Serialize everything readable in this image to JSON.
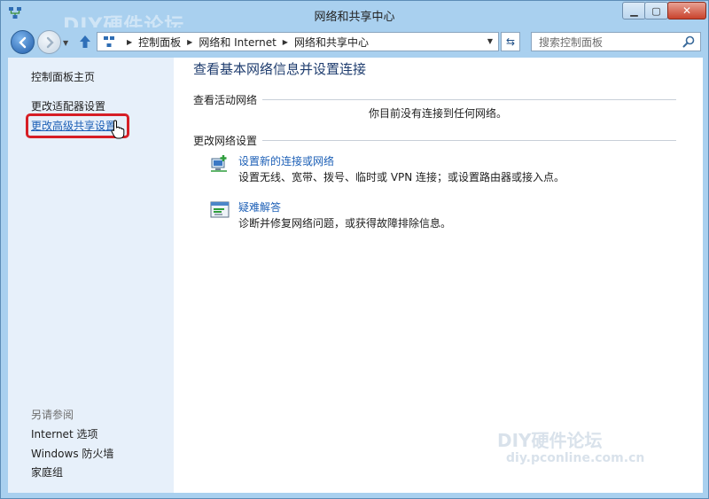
{
  "window": {
    "title": "网络和共享中心",
    "controls": {
      "minimize": "▁",
      "maximize": "▢",
      "close": "✕"
    }
  },
  "navigation": {
    "breadcrumbs": [
      "控制面板",
      "网络和 Internet",
      "网络和共享中心"
    ],
    "search_placeholder": "搜索控制面板"
  },
  "sidebar": {
    "items": [
      {
        "label": "控制面板主页"
      },
      {
        "label": "更改适配器设置"
      },
      {
        "label": "更改高级共享设置"
      }
    ],
    "see_also_title": "另请参阅",
    "see_also": [
      {
        "label": "Internet 选项"
      },
      {
        "label": "Windows 防火墙"
      },
      {
        "label": "家庭组"
      }
    ]
  },
  "main": {
    "title": "查看基本网络信息并设置连接",
    "active_networks": {
      "heading": "查看活动网络",
      "status": "你目前没有连接到任何网络。"
    },
    "change_settings": {
      "heading": "更改网络设置",
      "tasks": [
        {
          "link": "设置新的连接或网络",
          "description": "设置无线、宽带、拨号、临时或 VPN 连接；或设置路由器或接入点。",
          "icon": "new-connection-icon"
        },
        {
          "link": "疑难解答",
          "description": "诊断并修复网络问题，或获得故障排除信息。",
          "icon": "troubleshoot-icon"
        }
      ]
    }
  },
  "watermark": {
    "top": "DIY硬件论坛",
    "bottom_line1": "DIY硬件论坛",
    "bottom_line2": "diy.pconline.com.cn"
  },
  "colors": {
    "frame": "#a9d0ef",
    "sidebar_bg": "#e7f0fa",
    "link": "#1c5fb6",
    "highlight": "#d61f26",
    "close_button": "#c9432d"
  }
}
